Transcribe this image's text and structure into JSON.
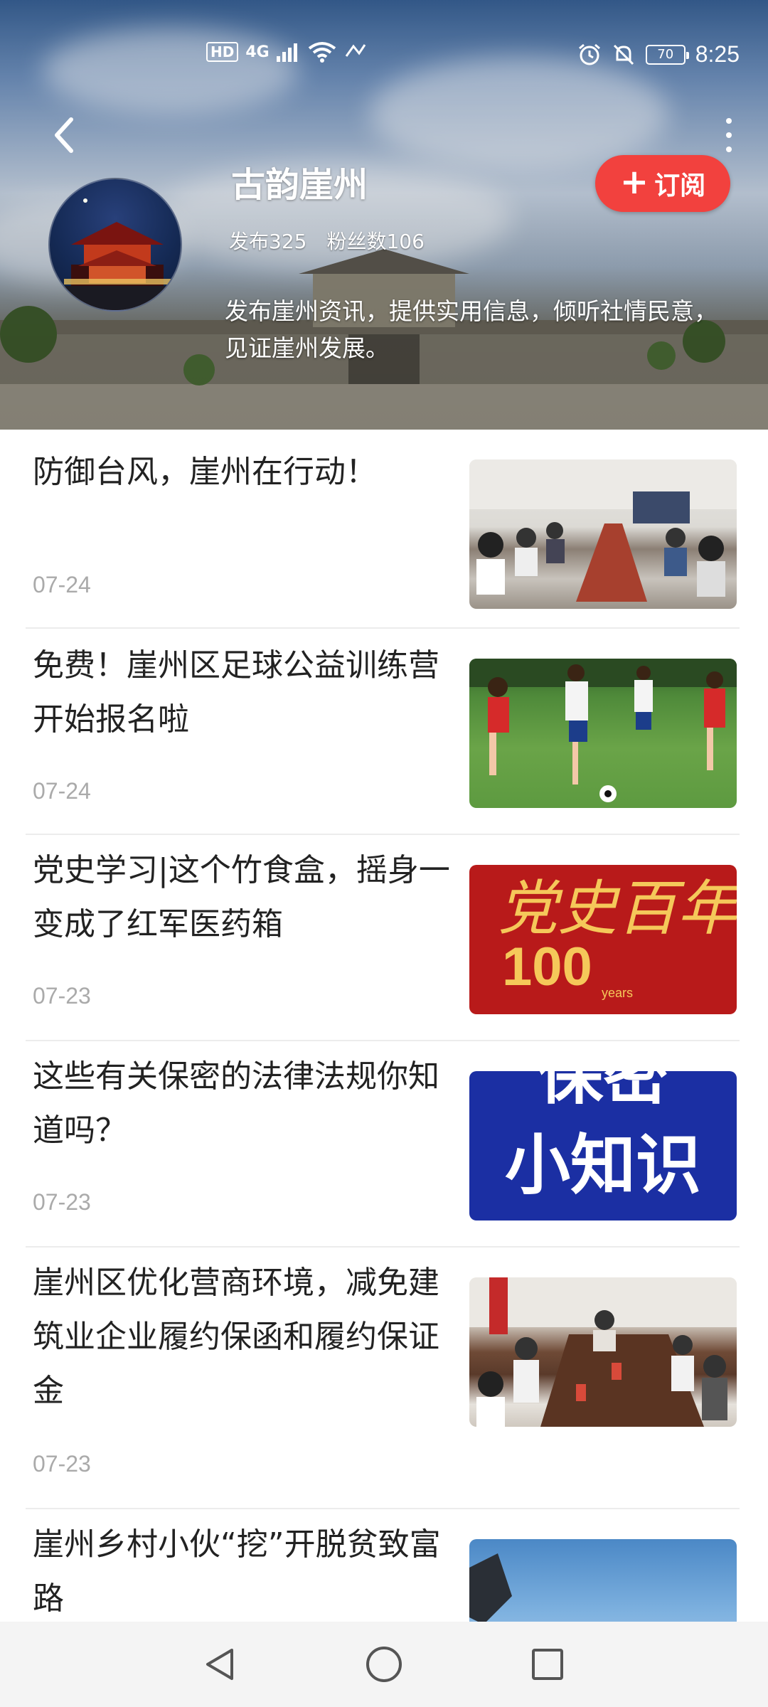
{
  "status_bar": {
    "network": "4G",
    "hd": "HD",
    "battery": "70",
    "time": "8:25"
  },
  "header": {
    "title": "古韵崖州",
    "posts": "发布325",
    "followers": "粉丝数106",
    "description": "发布崖州资讯，提供实用信息，倾听社情民意，见证崖州发展。",
    "subscribe_label": "订阅",
    "subscribe_color": "#f2413e"
  },
  "articles": [
    {
      "title": "防御台风，崖州在行动！",
      "date": "07-24",
      "thumb": "meeting-room"
    },
    {
      "title": "免费！崖州区足球公益训练营开始报名啦",
      "date": "07-24",
      "thumb": "soccer-kids"
    },
    {
      "title": "党史学习|这个竹食盒，摇身一变成了红军医药箱",
      "date": "07-23",
      "thumb": "party-100-years",
      "thumb_text": "党史百年",
      "thumb_number": "100",
      "thumb_small": "years"
    },
    {
      "title": "这些有关保密的法律法规你知道吗？",
      "date": "07-23",
      "thumb": "secrecy-knowledge",
      "thumb_text_top": "保密",
      "thumb_text_bottom": "小知识"
    },
    {
      "title": "崖州区优化营商环境，减免建筑业企业履约保函和履约保证金",
      "date": "07-23",
      "thumb": "meeting-table"
    },
    {
      "title": "崖州乡村小伙“挖”开脱贫致富路",
      "date": "",
      "thumb": "excavator-sky"
    }
  ],
  "nav": {
    "back": "back-triangle-icon",
    "home": "home-circle-icon",
    "recents": "recents-square-icon"
  }
}
